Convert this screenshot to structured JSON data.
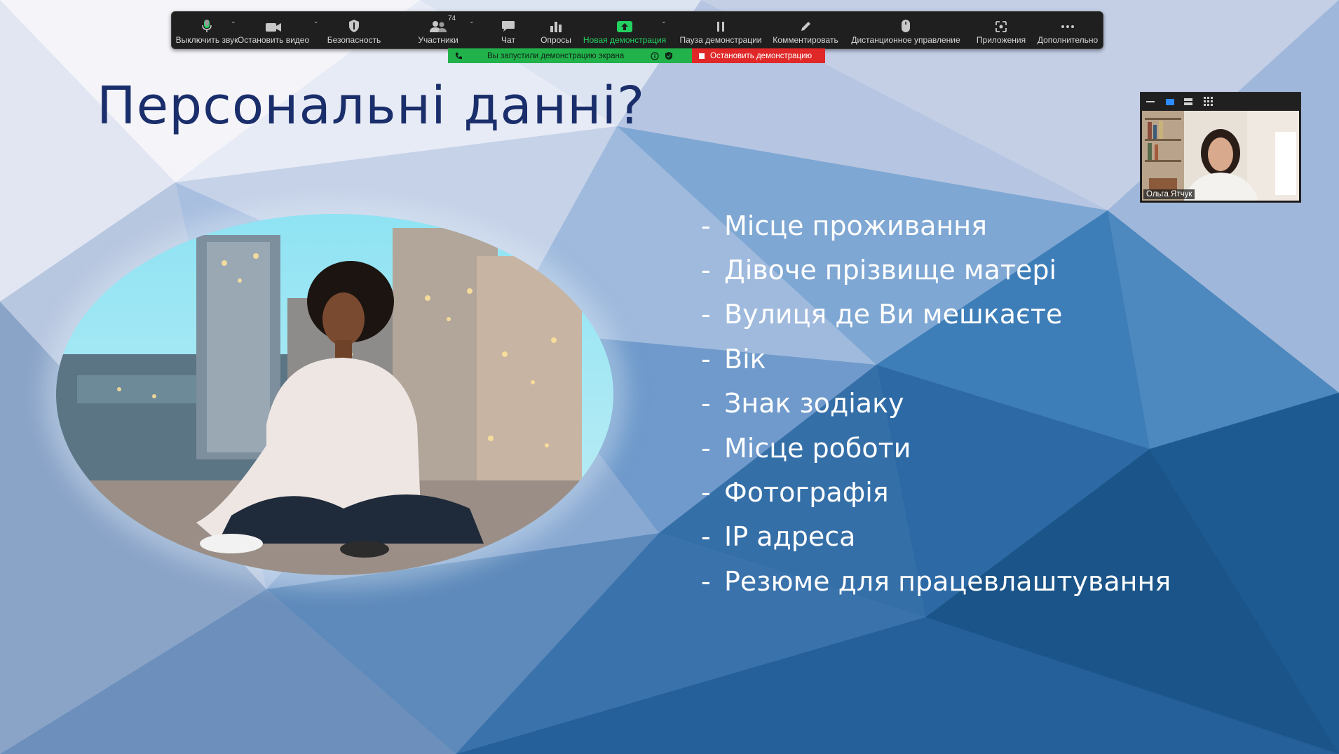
{
  "toolbar": {
    "mute": "Выключить звук",
    "stop_video": "Остановить видео",
    "security": "Безопасность",
    "participants": "Участники",
    "participants_count": "74",
    "chat": "Чат",
    "polls": "Опросы",
    "new_share": "Новая демонстрация",
    "pause_share": "Пауза демонстрации",
    "annotate": "Комментировать",
    "remote_control": "Дистанционное управление",
    "apps": "Приложения",
    "more": "Дополнительно"
  },
  "share_status": {
    "message": "Вы запустили демонстрацию экрана",
    "stop_label": "Остановить демонстрацию"
  },
  "slide": {
    "title": "Персональні данні?",
    "items": [
      "Місце проживання",
      "Дівоче прізвище матері",
      "Вулиця де Ви мешкаєте",
      "Вік",
      "Знак зодіаку",
      "Місце роботи",
      "Фотографія",
      "IP адреса",
      "Резюме для працевлаштування"
    ],
    "bullet": "-"
  },
  "self_view": {
    "name": "Ольга Ятчук"
  },
  "colors": {
    "toolbar_bg": "#1f1f1f",
    "active_green": "#23d160",
    "share_green": "#22b24c",
    "stop_red": "#e02828",
    "title_color": "#1a2e6b"
  }
}
